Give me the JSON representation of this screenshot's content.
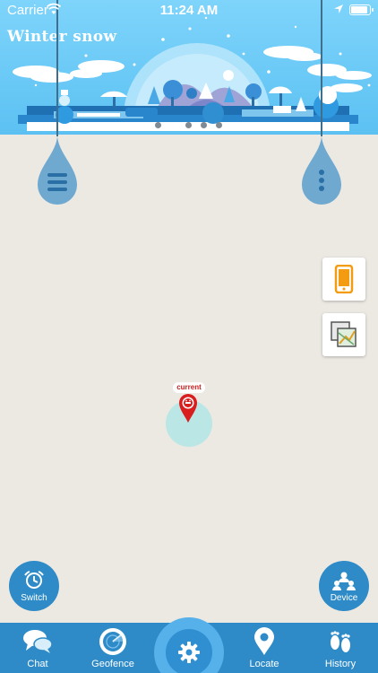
{
  "status_bar": {
    "carrier": "Carrier",
    "time": "11:24 AM"
  },
  "banner": {
    "title": "Winter snow",
    "dots": 5,
    "active_dot": 1
  },
  "map": {
    "current_label": "current",
    "pin_color": "#d81e1e"
  },
  "side_buttons": {
    "switch_label": "Switch",
    "device_label": "Device"
  },
  "tabs": [
    {
      "label": "Chat",
      "icon": "chat-icon"
    },
    {
      "label": "Geofence",
      "icon": "radar-icon"
    },
    {
      "label": "",
      "icon": "gear-icon"
    },
    {
      "label": "Locate",
      "icon": "location-pin-icon"
    },
    {
      "label": "History",
      "icon": "footprints-icon"
    }
  ],
  "colors": {
    "accent": "#2f8bc7",
    "banner": "#6ccbf7",
    "map": "#ece9e3",
    "drop": "#6fa9d0"
  }
}
